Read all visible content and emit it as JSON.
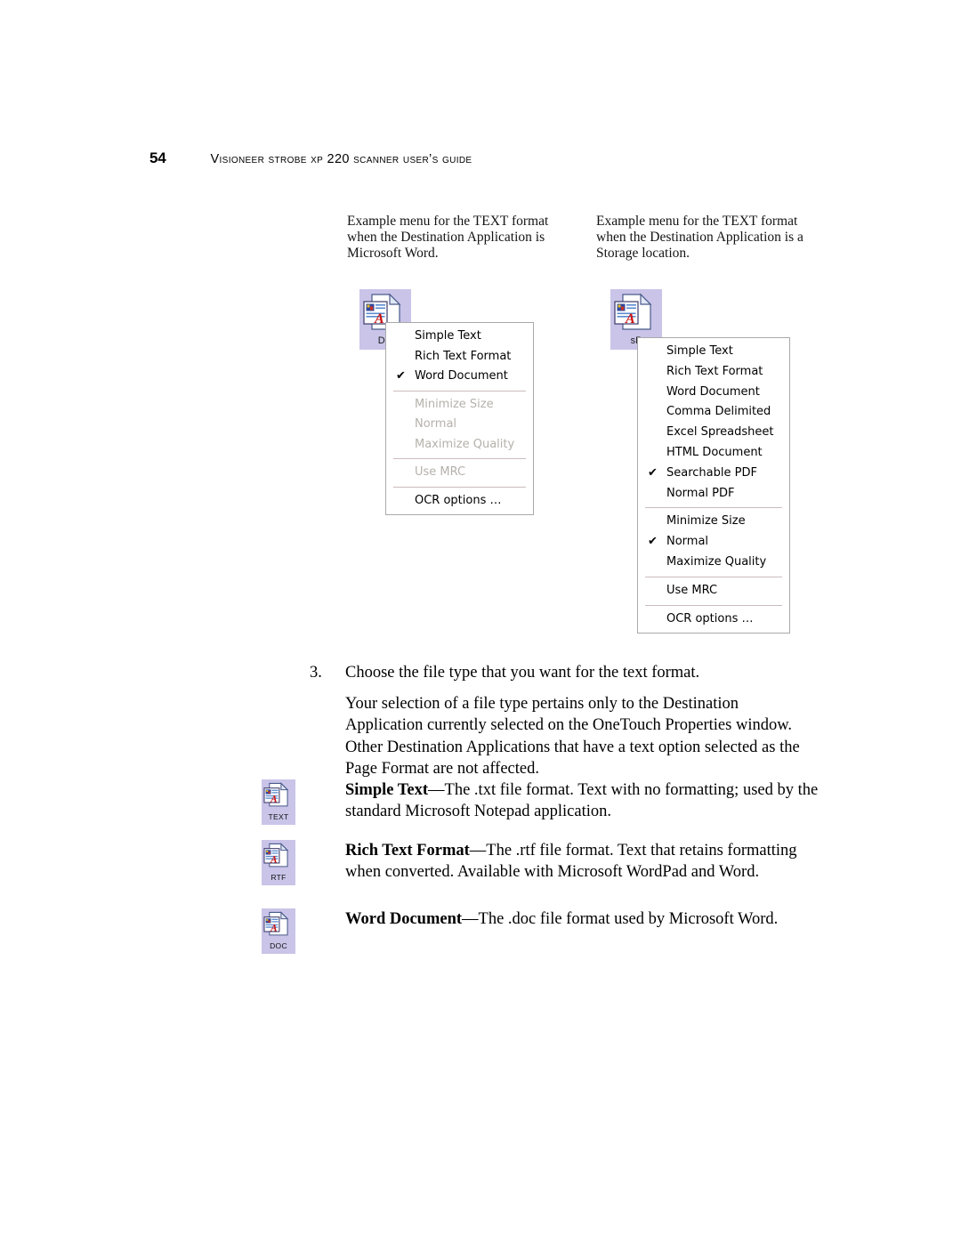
{
  "header": {
    "folio": "54",
    "running_title": "Visioneer Strobe XP 220 Scanner User’s Guide"
  },
  "figure": {
    "caption_left": "Example menu for the TEXT format when the Destination Application is Microsoft Word.",
    "caption_right": "Example menu for the TEXT format when the Destination Application is a Storage location.",
    "icon_left_label": "DO",
    "icon_right_label": "sP",
    "checkmark": "✔"
  },
  "menu_left": {
    "items": [
      {
        "label": "Simple Text",
        "checked": false,
        "disabled": false
      },
      {
        "label": "Rich Text Format",
        "checked": false,
        "disabled": false
      },
      {
        "label": "Word Document",
        "checked": true,
        "disabled": false
      },
      {
        "separator": true
      },
      {
        "label": "Minimize Size",
        "checked": false,
        "disabled": true
      },
      {
        "label": "Normal",
        "checked": false,
        "disabled": true
      },
      {
        "label": "Maximize Quality",
        "checked": false,
        "disabled": true
      },
      {
        "separator": true
      },
      {
        "label": "Use MRC",
        "checked": false,
        "disabled": true
      },
      {
        "separator": true
      },
      {
        "label": "OCR options …",
        "checked": false,
        "disabled": false
      }
    ]
  },
  "menu_right": {
    "items": [
      {
        "label": "Simple Text",
        "checked": false,
        "disabled": false
      },
      {
        "label": "Rich Text Format",
        "checked": false,
        "disabled": false
      },
      {
        "label": "Word Document",
        "checked": false,
        "disabled": false
      },
      {
        "label": "Comma Delimited",
        "checked": false,
        "disabled": false
      },
      {
        "label": "Excel Spreadsheet",
        "checked": false,
        "disabled": false
      },
      {
        "label": "HTML Document",
        "checked": false,
        "disabled": false
      },
      {
        "label": "Searchable PDF",
        "checked": true,
        "disabled": false
      },
      {
        "label": "Normal PDF",
        "checked": false,
        "disabled": false
      },
      {
        "separator": true
      },
      {
        "label": "Minimize Size",
        "checked": false,
        "disabled": false
      },
      {
        "label": "Normal",
        "checked": true,
        "disabled": false
      },
      {
        "label": "Maximize Quality",
        "checked": false,
        "disabled": false
      },
      {
        "separator": true
      },
      {
        "label": "Use MRC",
        "checked": false,
        "disabled": false
      },
      {
        "separator": true
      },
      {
        "label": "OCR options …",
        "checked": false,
        "disabled": false
      }
    ]
  },
  "step": {
    "number": "3.",
    "lead": "Choose the file type that you want for the text format.",
    "body": "Your selection of a file type pertains only to the Destination Application currently selected on the OneTouch Properties window. Other Destination Applications that have a text option selected as the Page Format are not affected."
  },
  "formats": [
    {
      "icon_label": "TEXT",
      "lead": "Simple Text",
      "description": "—The .txt file format. Text with no formatting; used by the standard Microsoft Notepad application."
    },
    {
      "icon_label": "RTF",
      "lead": "Rich Text Format",
      "description": "—The .rtf file format. Text that retains formatting when converted. Available with Microsoft WordPad and Word."
    },
    {
      "icon_label": "DOC",
      "lead": "Word Document",
      "description": "—The .doc file format used by Microsoft Word."
    }
  ],
  "colors": {
    "icon_selection_bg": "#c9c4e8",
    "menu_border": "#a9a9a9",
    "menu_separator": "#cbbcbc",
    "disabled_text": "#b5b1aa",
    "page_bg": "#ffffff"
  }
}
